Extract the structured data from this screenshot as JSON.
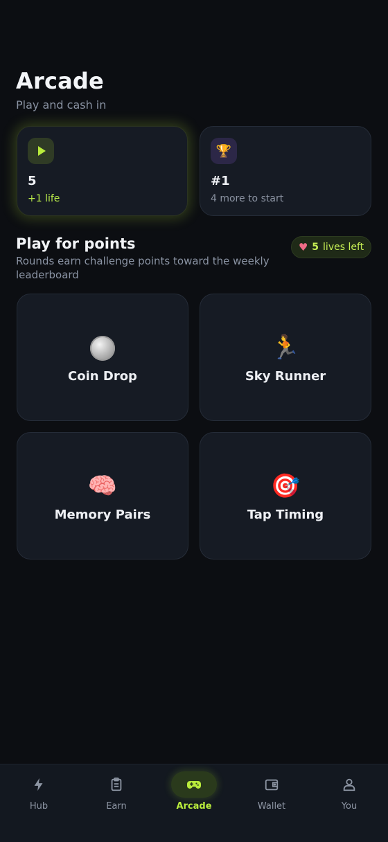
{
  "header": {
    "title": "Arcade",
    "subtitle": "Play and cash in"
  },
  "stats": {
    "lives": {
      "icon": "play-icon",
      "value": "5",
      "sub": "+1 life"
    },
    "rank": {
      "icon": "trophy-icon",
      "value": "#1",
      "sub": "4 more to start"
    }
  },
  "section": {
    "title": "Play for points",
    "description": "Rounds earn challenge points toward the weekly leaderboard",
    "lives_pill": {
      "icon": "heart-icon",
      "count": "5",
      "label": "lives left"
    }
  },
  "games": [
    {
      "icon": "coin-icon",
      "name": "Coin Drop"
    },
    {
      "icon": "runner-icon",
      "emoji": "🏃",
      "name": "Sky Runner"
    },
    {
      "icon": "brain-icon",
      "emoji": "🧠",
      "name": "Memory Pairs"
    },
    {
      "icon": "target-icon",
      "emoji": "🎯",
      "name": "Tap Timing"
    }
  ],
  "nav": {
    "active": "Arcade",
    "items": [
      {
        "icon": "bolt-icon",
        "label": "Hub"
      },
      {
        "icon": "clipboard-icon",
        "label": "Earn"
      },
      {
        "icon": "gamepad-icon",
        "label": "Arcade"
      },
      {
        "icon": "wallet-icon",
        "label": "Wallet"
      },
      {
        "icon": "user-icon",
        "label": "You"
      }
    ]
  },
  "colors": {
    "background": "#0c0e12",
    "card": "#161b24",
    "accent": "#b9ec3c",
    "heart": "#f06b86",
    "muted_text": "#8a93a3"
  }
}
